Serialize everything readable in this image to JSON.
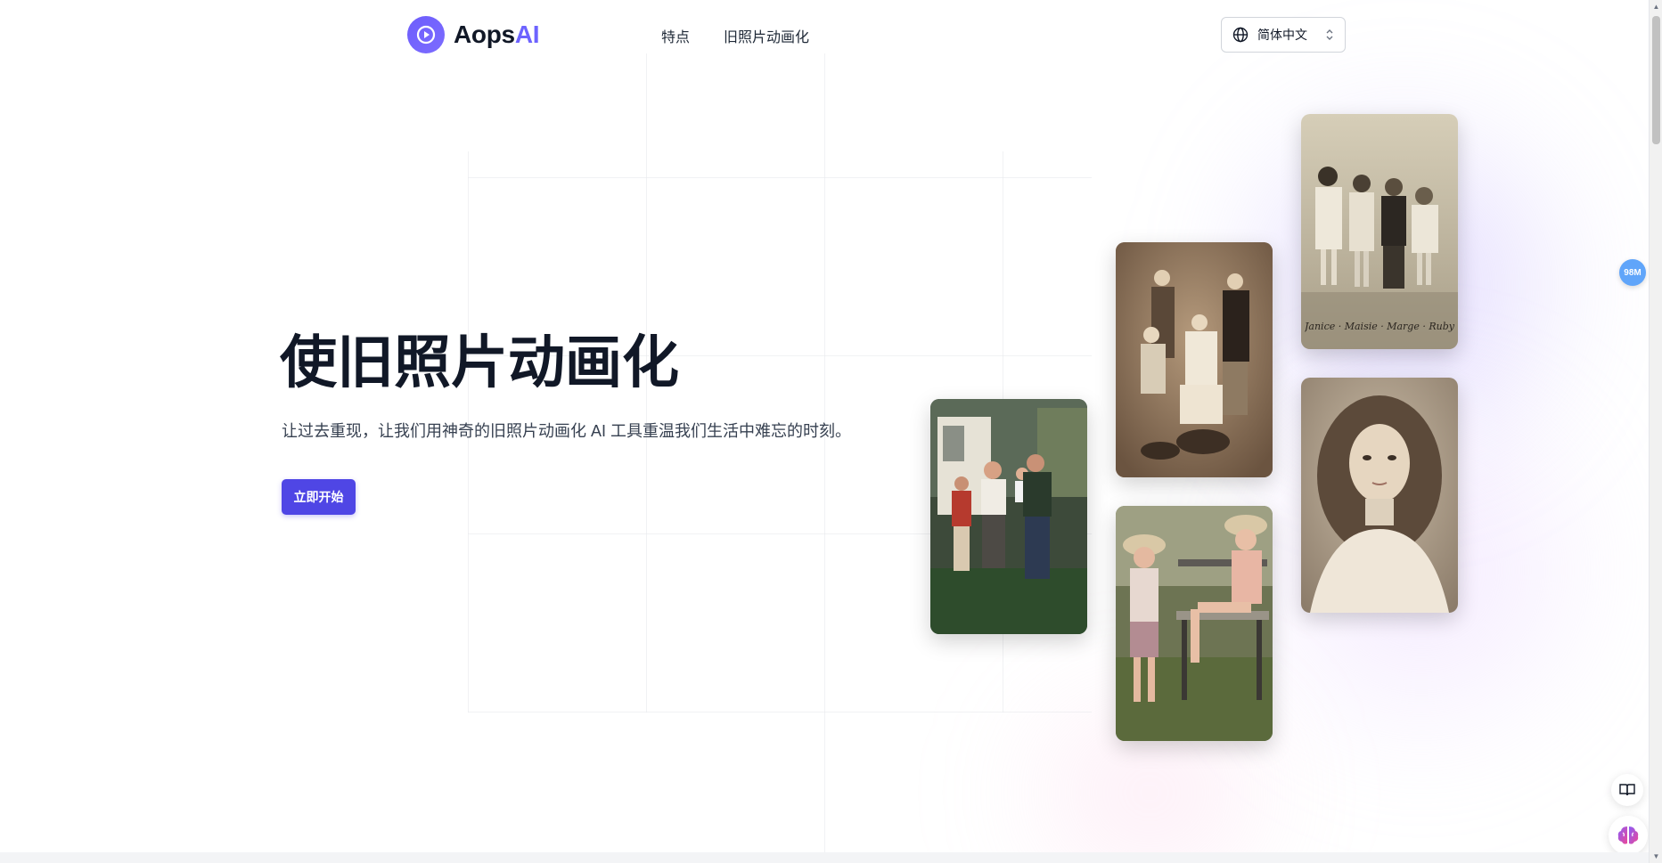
{
  "header": {
    "logo_text_primary": "Aops",
    "logo_text_accent": "AI",
    "nav": [
      {
        "label": "特点"
      },
      {
        "label": "旧照片动画化"
      }
    ],
    "language": {
      "selected": "简体中文"
    }
  },
  "hero": {
    "title": "使旧照片动画化",
    "subtitle": "让过去重现，让我们用神奇的旧照片动画化 AI 工具重温我们生活中难忘的时刻。",
    "cta_label": "立即开始"
  },
  "gallery": {
    "photos": [
      {
        "name": "family-color-photo"
      },
      {
        "name": "family-sepia-photo"
      },
      {
        "name": "girls-garden-photo"
      },
      {
        "name": "children-sepia-photo"
      },
      {
        "name": "girl-portrait-photo"
      }
    ],
    "handwriting_caption": "Janice · Maisie · Marge · Ruby"
  },
  "widgets": {
    "memory_badge": "98M",
    "book_icon": "book-open-icon",
    "brain_icon": "brain-icon"
  },
  "colors": {
    "brand": "#4f46e5",
    "logo_accent": "#6d63ff",
    "badge": "#60a5fa",
    "text": "#111827"
  }
}
